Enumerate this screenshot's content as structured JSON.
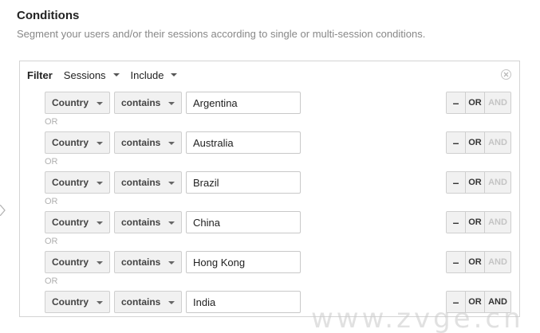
{
  "section": {
    "title": "Conditions",
    "description": "Segment your users and/or their sessions according to single or multi-session conditions."
  },
  "filter": {
    "label": "Filter",
    "scope": "Sessions",
    "mode": "Include"
  },
  "separator_label": "OR",
  "buttons": {
    "remove": "–",
    "or": "OR",
    "and": "AND"
  },
  "conditions": [
    {
      "dimension": "Country",
      "operator": "contains",
      "value": "Argentina",
      "and_enabled": false
    },
    {
      "dimension": "Country",
      "operator": "contains",
      "value": "Australia",
      "and_enabled": false
    },
    {
      "dimension": "Country",
      "operator": "contains",
      "value": "Brazil",
      "and_enabled": false
    },
    {
      "dimension": "Country",
      "operator": "contains",
      "value": "China",
      "and_enabled": false
    },
    {
      "dimension": "Country",
      "operator": "contains",
      "value": "Hong Kong",
      "and_enabled": false
    },
    {
      "dimension": "Country",
      "operator": "contains",
      "value": "India",
      "and_enabled": true
    }
  ],
  "watermark": "www.zvge.cn",
  "colors": {
    "accent_text": "#222222",
    "muted_text": "#888888",
    "disabled_button_text": "#c4c4c4"
  }
}
